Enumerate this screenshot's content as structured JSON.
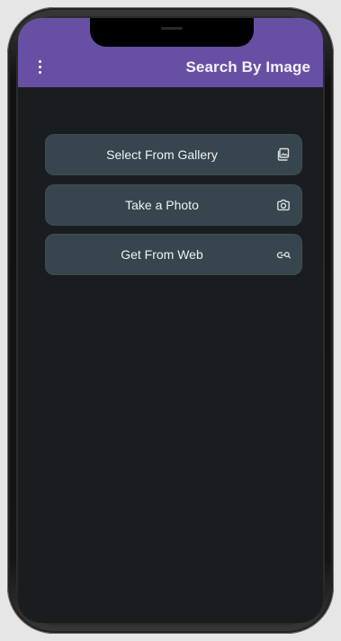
{
  "app": {
    "title": "Search By Image"
  },
  "actions": [
    {
      "label": "Select From Gallery",
      "icon": "gallery-icon"
    },
    {
      "label": "Take a Photo",
      "icon": "camera-icon"
    },
    {
      "label": "Get From Web",
      "icon": "web-search-icon"
    }
  ],
  "colors": {
    "appbar": "#6750a4",
    "screen_background": "#1a1d20",
    "button_background": "#37454e",
    "text": "#eef2f4"
  }
}
